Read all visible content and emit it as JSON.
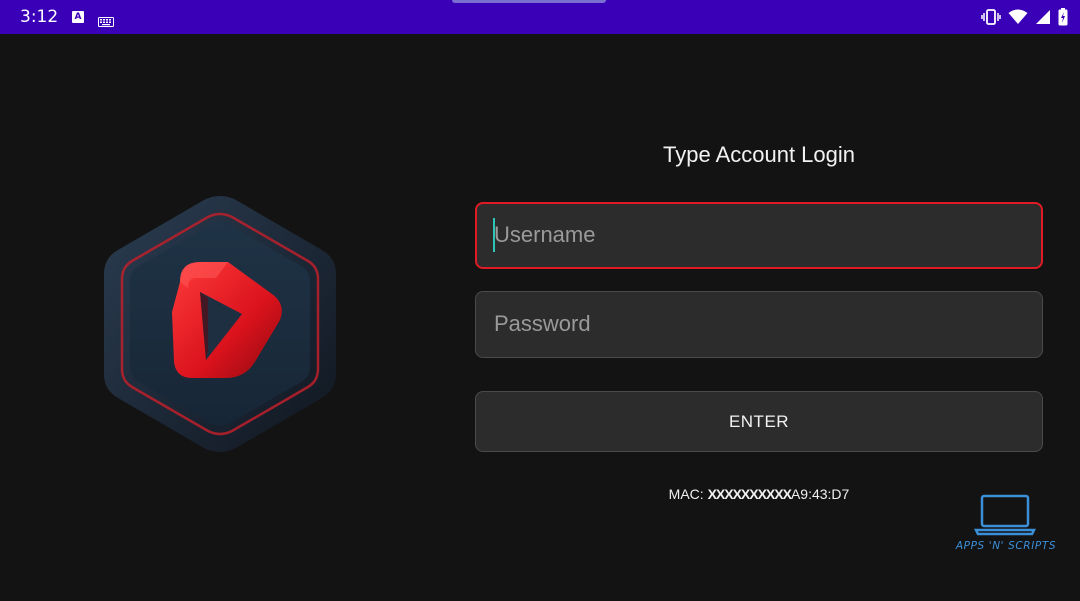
{
  "status_bar": {
    "time": "3:12",
    "a_icon_letter": "A",
    "icons_left": [
      "a-badge-icon",
      "keyboard-icon"
    ],
    "icons_right": [
      "vibrate-icon",
      "wifi-icon",
      "signal-icon",
      "battery-charging-icon"
    ],
    "background": "#3a00b8"
  },
  "login": {
    "title": "Type Account Login",
    "username_placeholder": "Username",
    "password_placeholder": "Password",
    "enter_label": "ENTER",
    "mac_prefix": "MAC: ",
    "mac_redacted": "XXXXXXXXXX",
    "mac_suffix": "A9:43:D7",
    "focus_color": "#e01b24"
  },
  "watermark": {
    "text": "APPS 'N' SCRIPTS",
    "icon": "laptop-icon",
    "color": "#3b8fd8"
  },
  "logo": {
    "icon": "play-hexagon-logo-icon",
    "accent": "#e0202a"
  }
}
